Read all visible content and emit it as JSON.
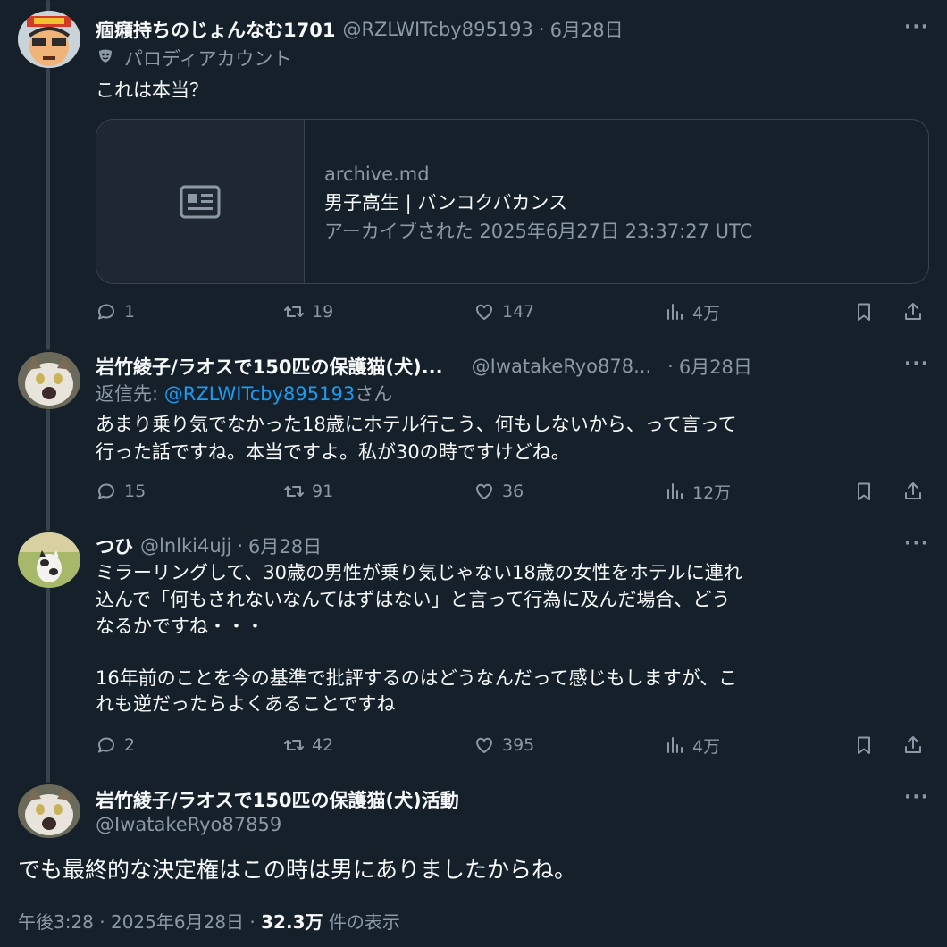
{
  "tweets": [
    {
      "name": "痼癪持ちのじょんなむ1701",
      "handle": "@RZLWITcby895193",
      "date": "6月28日",
      "label_icon": "theater-masks",
      "label": "パロディアカウント",
      "text": [
        "これは本当？"
      ],
      "card": {
        "domain": "archive.md",
        "title": "男子高生 | バンコクバカンス",
        "meta": "アーカイブされた 2025年6月27日 23:37:27 UTC"
      },
      "stats": {
        "replies": "1",
        "retweets": "19",
        "likes": "147",
        "views": "4万"
      }
    },
    {
      "name": "岩竹綾子/ラオスで150匹の保護猫(犬)...",
      "handle": "@IwatakeRyo878...",
      "date": "6月28日",
      "reply_prefix": "返信先: ",
      "reply_to": "@RZLWITcby895193",
      "reply_suffix": "さん",
      "text": [
        "あまり乗り気でなかった18歳にホテル行こう、何もしないから、って言って",
        "行った話ですね。本当ですよ。私が30の時ですけどね。"
      ],
      "stats": {
        "replies": "15",
        "retweets": "91",
        "likes": "36",
        "views": "12万"
      }
    },
    {
      "name": "つひ",
      "handle": "@lnlki4ujj",
      "date": "6月28日",
      "text": [
        "ミラーリングして、30歳の男性が乗り気じゃない18歳の女性をホテルに連れ",
        "込んで「何もされないなんてはずはない」と言って行為に及んだ場合、どう",
        "なるかですね・・・",
        "",
        "16年前のことを今の基準で批評するのはどうなんだって感じもしますが、こ",
        "れも逆だったらよくあることですね"
      ],
      "stats": {
        "replies": "2",
        "retweets": "42",
        "likes": "395",
        "views": "4万"
      }
    }
  ],
  "main": {
    "name": "岩竹綾子/ラオスで150匹の保護猫(犬)活動",
    "handle": "@IwatakeRyo87859",
    "text": "でも最終的な決定権はこの時は男にありましたからね。",
    "time": "午後3:28 · 2025年6月28日 · ",
    "views": "32.3万",
    "views_suffix": " 件の表示"
  },
  "more_label": "···",
  "colors": {
    "background": "#15202b",
    "text": "#f7f9f9",
    "muted": "#8b98a5",
    "link": "#1d9bf0",
    "border": "#38444d"
  }
}
